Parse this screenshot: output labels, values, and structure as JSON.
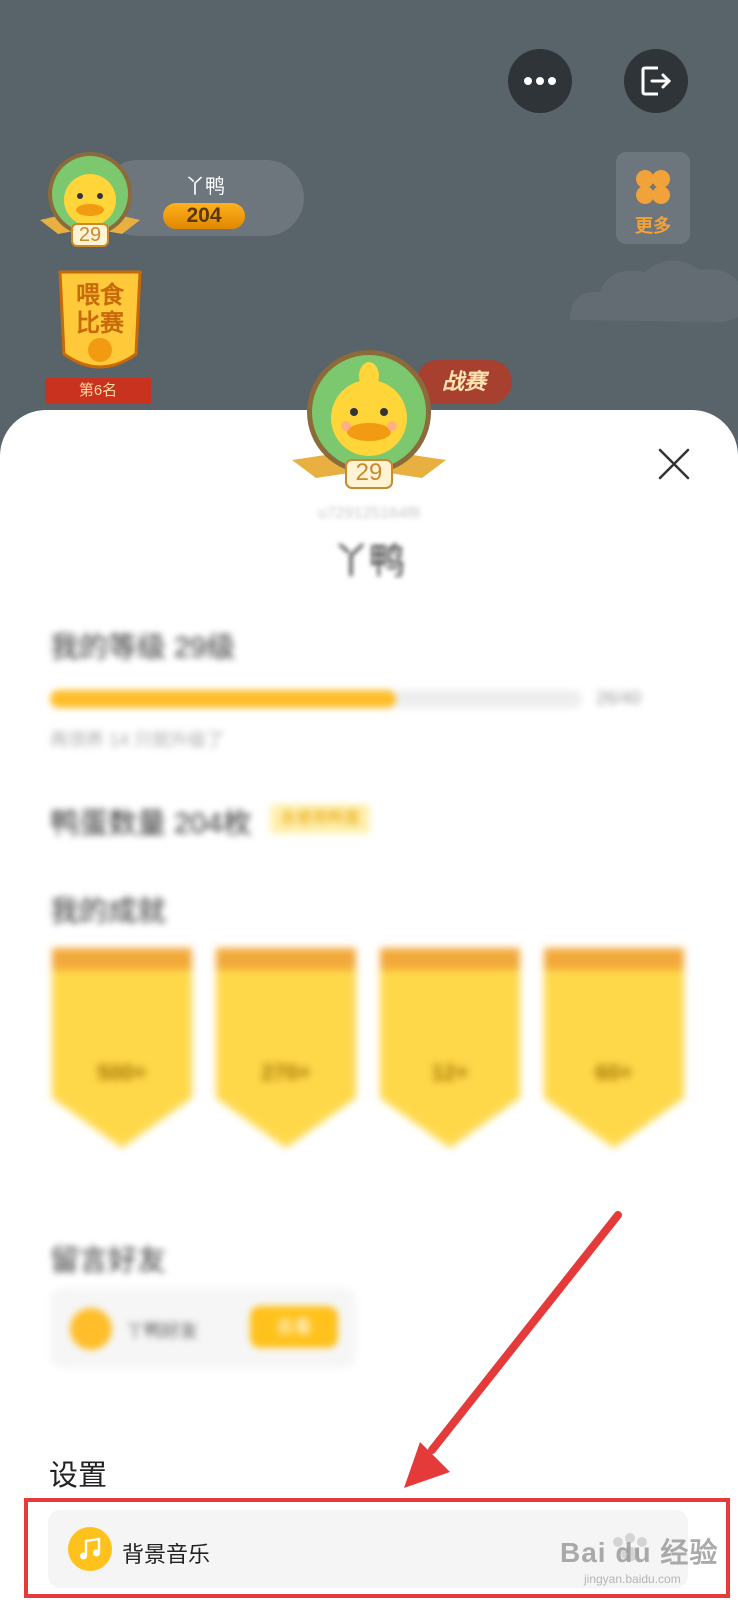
{
  "header": {
    "more_icon": "ellipsis-icon",
    "exit_icon": "exit-icon",
    "player": {
      "name": "丫鸭",
      "score": "204",
      "level": "29"
    },
    "more_button": {
      "icon": "clover-icon",
      "label": "更多"
    },
    "feed_contest": {
      "title_line1": "喂食",
      "title_line2": "比赛",
      "rank": "第6名"
    },
    "challenge_badge": "战赛"
  },
  "profile": {
    "level": "29",
    "uid": "u729125164f8",
    "name": "丫鸭",
    "level_label": "我的等级 29级",
    "progress": {
      "fraction": 0.65,
      "text": "26/40",
      "hint": "再领养 14 只就升级了"
    },
    "eggs_label": "鸭蛋数量 204枚",
    "eggs_badge": "去使用鸭蛋",
    "achievements_label": "我的成就",
    "achievements": [
      "500+",
      "270+",
      "12+",
      "60+"
    ],
    "friends_label": "留言好友",
    "friend": {
      "name": "丫鸭好友",
      "button": "去看"
    }
  },
  "settings": {
    "title": "设置",
    "music": {
      "icon": "music-note-icon",
      "label": "背景音乐"
    }
  },
  "watermark": {
    "text": "Bai du 经验",
    "url": "jingyan.baidu.com"
  },
  "colors": {
    "accent": "#ffbe2a",
    "annotation_red": "#e43a3a",
    "sheet_bg": "#ffffff"
  }
}
